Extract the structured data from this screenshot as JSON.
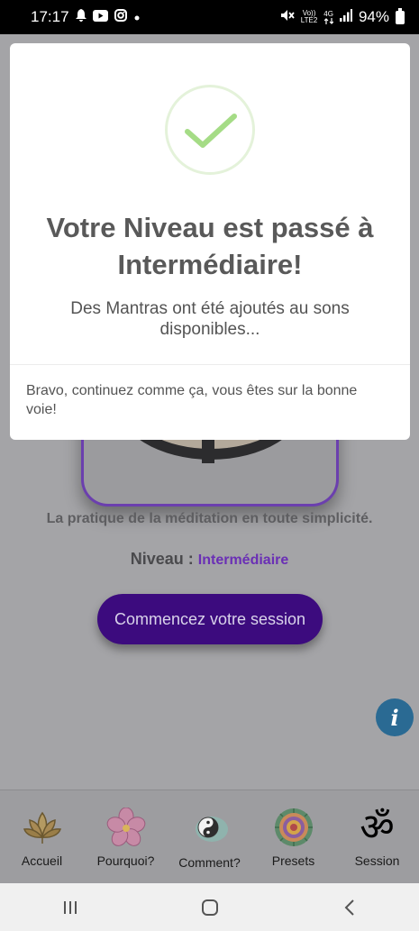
{
  "status_bar": {
    "time": "17:17",
    "notification_icons": [
      "bell-icon",
      "youtube-icon",
      "instagram-icon",
      "dot-icon"
    ],
    "system_icons": [
      "mute-icon",
      "volte-icon",
      "4g-icon",
      "signal-icon"
    ],
    "net_label_top": "Vo))",
    "net_label_bottom": "LTE2",
    "net_type": "4G",
    "battery": "94%"
  },
  "dialog": {
    "icon": "check-icon",
    "success_color": "#a5dc86",
    "title": "Votre Niveau est passé à Intermédiaire!",
    "text": "Des Mantras ont été ajoutés au sons disponibles...",
    "footer": "Bravo, continuez comme ça, vous êtes sur la bonne voie!"
  },
  "main": {
    "tagline": "La pratique de la méditation en toute simplicité.",
    "level_label": "Niveau :",
    "level_value": "Intermédiaire",
    "start_button": "Commencez votre session",
    "info_icon": "info-icon",
    "accent_color": "#3c0b7e"
  },
  "bottom_nav": {
    "items": [
      {
        "label": "Accueil",
        "icon": "lotus-icon"
      },
      {
        "label": "Pourquoi?",
        "icon": "flower-icon"
      },
      {
        "label": "Comment?",
        "icon": "yin-yang-icon"
      },
      {
        "label": "Presets",
        "icon": "mandala-icon"
      },
      {
        "label": "Session",
        "icon": "om-icon"
      }
    ]
  },
  "system_nav": {
    "icons": [
      "recents-icon",
      "home-icon",
      "back-icon"
    ]
  }
}
